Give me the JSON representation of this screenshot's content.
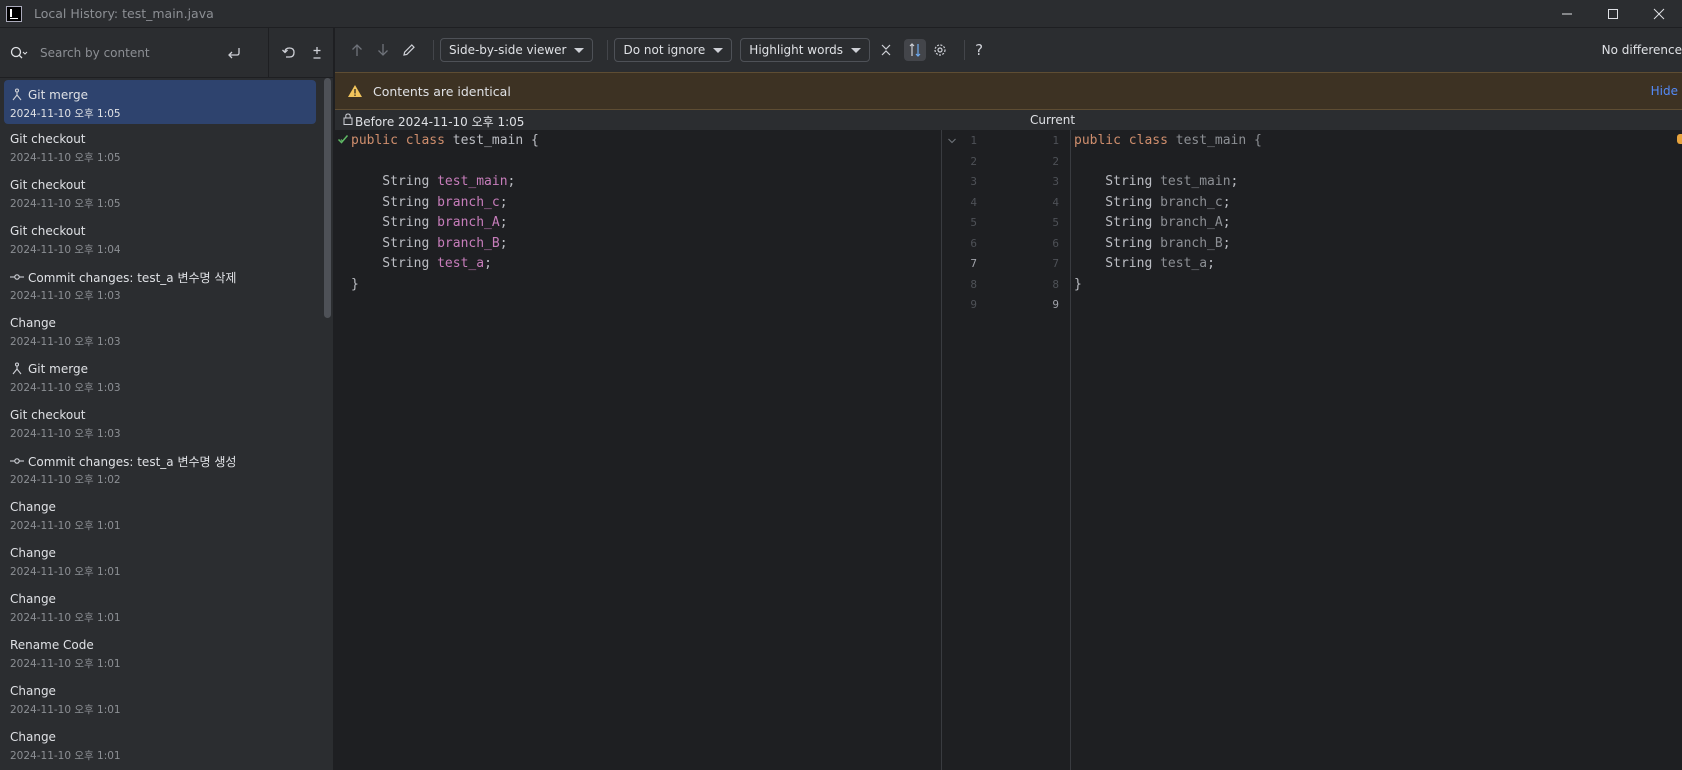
{
  "window": {
    "title": "Local History: test_main.java"
  },
  "search": {
    "placeholder": "Search by content"
  },
  "history": [
    {
      "title": "Git merge",
      "date": "2024-11-10 오후 1:05",
      "icon": "merge-icon",
      "selected": true
    },
    {
      "title": "Git checkout",
      "date": "2024-11-10 오후 1:05",
      "icon": ""
    },
    {
      "title": "Git checkout",
      "date": "2024-11-10 오후 1:05",
      "icon": ""
    },
    {
      "title": "Git checkout",
      "date": "2024-11-10 오후 1:04",
      "icon": ""
    },
    {
      "title": "Commit changes: test_a 변수명 삭제",
      "date": "2024-11-10 오후 1:03",
      "icon": "commit-icon"
    },
    {
      "title": "Change",
      "date": "2024-11-10 오후 1:03",
      "icon": ""
    },
    {
      "title": "Git merge",
      "date": "2024-11-10 오후 1:03",
      "icon": "merge-icon"
    },
    {
      "title": "Git checkout",
      "date": "2024-11-10 오후 1:03",
      "icon": ""
    },
    {
      "title": "Commit changes: test_a 변수명 생성",
      "date": "2024-11-10 오후 1:02",
      "icon": "commit-icon"
    },
    {
      "title": "Change",
      "date": "2024-11-10 오후 1:01",
      "icon": ""
    },
    {
      "title": "Change",
      "date": "2024-11-10 오후 1:01",
      "icon": ""
    },
    {
      "title": "Change",
      "date": "2024-11-10 오후 1:01",
      "icon": ""
    },
    {
      "title": "Rename Code",
      "date": "2024-11-10 오후 1:01",
      "icon": ""
    },
    {
      "title": "Change",
      "date": "2024-11-10 오후 1:01",
      "icon": ""
    },
    {
      "title": "Change",
      "date": "2024-11-10 오후 1:01",
      "icon": ""
    }
  ],
  "toolbar": {
    "viewer": "Side-by-side viewer",
    "ignore": "Do not ignore",
    "highlight": "Highlight words",
    "help": "?",
    "status": "No difference"
  },
  "banner": {
    "text": "Contents are identical",
    "hide": "Hide"
  },
  "diff": {
    "before_label": "Before 2024-11-10 오후 1:05",
    "current_label": "Current",
    "left_lines": [
      [
        {
          "t": "public ",
          "c": "kw"
        },
        {
          "t": "class ",
          "c": "kw"
        },
        {
          "t": "test_main {",
          "c": "plain"
        }
      ],
      [],
      [
        {
          "t": "    String ",
          "c": "plain"
        },
        {
          "t": "test_main",
          "c": "field"
        },
        {
          "t": ";",
          "c": "plain"
        }
      ],
      [
        {
          "t": "    String ",
          "c": "plain"
        },
        {
          "t": "branch_c",
          "c": "field"
        },
        {
          "t": ";",
          "c": "plain"
        }
      ],
      [
        {
          "t": "    String ",
          "c": "plain"
        },
        {
          "t": "branch_A",
          "c": "field"
        },
        {
          "t": ";",
          "c": "plain"
        }
      ],
      [
        {
          "t": "    String ",
          "c": "plain"
        },
        {
          "t": "branch_B",
          "c": "field"
        },
        {
          "t": ";",
          "c": "plain"
        }
      ],
      [
        {
          "t": "    String ",
          "c": "plain"
        },
        {
          "t": "test_a",
          "c": "field"
        },
        {
          "t": ";",
          "c": "plain"
        }
      ],
      [
        {
          "t": "}",
          "c": "plain"
        }
      ]
    ],
    "right_lines": [
      [
        {
          "t": "public ",
          "c": "kw"
        },
        {
          "t": "class ",
          "c": "kw"
        },
        {
          "t": "test_main {",
          "c": "plain-dim"
        }
      ],
      [],
      [
        {
          "t": "    String ",
          "c": "plain"
        },
        {
          "t": "test_main",
          "c": "field-dim"
        },
        {
          "t": ";",
          "c": "plain"
        }
      ],
      [
        {
          "t": "    String ",
          "c": "plain"
        },
        {
          "t": "branch_c",
          "c": "field-dim"
        },
        {
          "t": ";",
          "c": "plain"
        }
      ],
      [
        {
          "t": "    String ",
          "c": "plain"
        },
        {
          "t": "branch_A",
          "c": "field-dim"
        },
        {
          "t": ";",
          "c": "plain"
        }
      ],
      [
        {
          "t": "    String ",
          "c": "plain"
        },
        {
          "t": "branch_B",
          "c": "field-dim"
        },
        {
          "t": ";",
          "c": "plain"
        }
      ],
      [
        {
          "t": "    String ",
          "c": "plain"
        },
        {
          "t": "test_a",
          "c": "field-dim"
        },
        {
          "t": ";",
          "c": "plain"
        }
      ],
      [
        {
          "t": "}",
          "c": "plain"
        }
      ]
    ],
    "left_numbers": [
      "1",
      "2",
      "3",
      "4",
      "5",
      "6",
      "7",
      "8",
      "9"
    ],
    "right_numbers": [
      "1",
      "2",
      "3",
      "4",
      "5",
      "6",
      "7",
      "8",
      "9"
    ],
    "highlighted_left": [
      "7"
    ],
    "highlighted_right": [
      "9"
    ]
  },
  "colors": {
    "keyword": "#cf8e6d",
    "field": "#c77dbb",
    "selection": "#2e436e",
    "banner": "#3d3223",
    "link": "#548af7"
  }
}
